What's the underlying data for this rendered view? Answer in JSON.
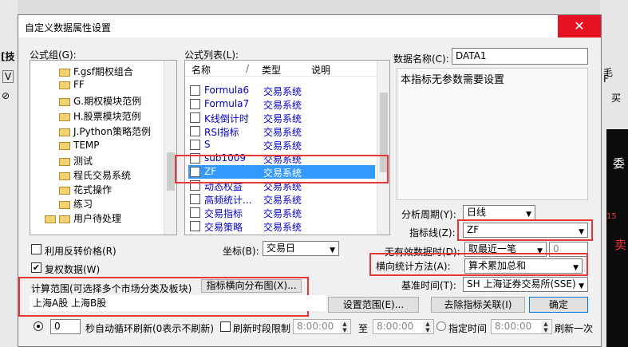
{
  "background": {
    "left_fragments": [
      "[技",
      "V",
      "⊘"
    ],
    "right_fragments": [
      "毛",
      "F",
      "买",
      "委",
      "15",
      "卖"
    ]
  },
  "dialog": {
    "title": "自定义数据属性设置",
    "close_glyph": "✕",
    "group_label": "公式组(G):",
    "groups": [
      "F.gsf期权组合",
      "FF",
      "G.期权模块范例",
      "H.股票模块范例",
      "J.Python策略范例",
      "TEMP",
      "测试",
      "程氏交易系统",
      "花式操作",
      "练习",
      "用户待处理"
    ],
    "formula_list_label": "公式列表(L):",
    "columns": {
      "name": "名称",
      "sort": "/",
      "type": "类型",
      "desc": "说明"
    },
    "formulas": [
      {
        "name": "Formula6",
        "type": "交易系统"
      },
      {
        "name": "Formula7",
        "type": "交易系统"
      },
      {
        "name": "K线倒计时",
        "type": "交易系统"
      },
      {
        "name": "RSI指标",
        "type": "交易系统"
      },
      {
        "name": "S",
        "type": "交易系统"
      },
      {
        "name": "sub1009",
        "type": "交易系统"
      },
      {
        "name": "ZF",
        "type": "交易系统"
      },
      {
        "name": "动态权益",
        "type": "交易系统"
      },
      {
        "name": "高频统计...",
        "type": "交易系统"
      },
      {
        "name": "交易指标",
        "type": "交易系统"
      },
      {
        "name": "交易策略",
        "type": "交易系统"
      }
    ],
    "data_name_label": "数据名称(C):",
    "data_name_value": "DATA1",
    "description_text": "本指标无参数需要设置",
    "period_label": "分析周期(Y):",
    "period_value": "日线",
    "indicator_line_label": "指标线(Z):",
    "indicator_line_value": "ZF",
    "invalid_data_label": "无有效数据时(D):",
    "invalid_data_value": "取最近一笔",
    "invalid_data_spin": "0",
    "horizontal_stat_label": "横向统计方法(A):",
    "horizontal_stat_value": "算术累加总和",
    "reference_time_label": "基准时间(T):",
    "reference_time_value": "SH 上海证券交易所(SSE)",
    "use_reverse_price_label": "利用反转价格(R)",
    "use_reverse_price_checked": false,
    "rights_data_label": "复权数据(W)",
    "rights_data_checked": true,
    "coordinate_label": "坐标(B):",
    "coordinate_value": "交易日",
    "calc_range_label": "计算范围(可选择多个市场分类及板块)",
    "horizontal_dist_button": "指标横向分布图(X)...",
    "calc_range_value": "上海A股  上海B股",
    "set_range_button": "设置范围(E)...",
    "remove_link_button": "去除指标关联(I)",
    "ok_button": "确定",
    "refresh_seconds": "0",
    "auto_refresh_label": "秒自动循环刷新(0表示不刷新)",
    "refresh_period_limit_label": "刷新时段限制",
    "time_from": "8:00:00",
    "to_label": "至",
    "time_to": "8:00:00",
    "specified_time_label": "指定时间",
    "specified_time": "8:00:00",
    "refresh_once_label": "刷新一次"
  }
}
